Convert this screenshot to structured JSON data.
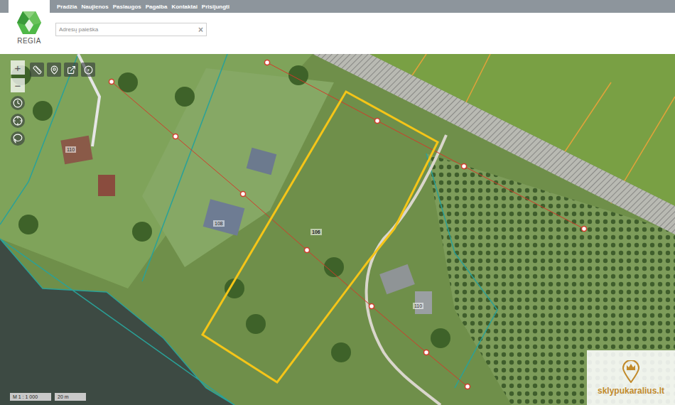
{
  "header": {
    "logo": "REGIA",
    "nav": [
      "Pradžia",
      "Naujienos",
      "Paslaugos",
      "Pagalba",
      "Kontaktai",
      "Prisijungti"
    ]
  },
  "search": {
    "placeholder": "Adresų paieška",
    "clear": "×"
  },
  "zoom": {
    "in": "+",
    "out": "−"
  },
  "parcels": [
    {
      "number": "110",
      "selected": false
    },
    {
      "number": "108",
      "selected": false
    },
    {
      "number": "106",
      "selected": true
    },
    {
      "number": "110",
      "selected": false
    }
  ],
  "scale": {
    "ratio": "M 1 : 1 000",
    "distance": "20 m"
  },
  "watermark": {
    "text": "sklypukaralius.lt"
  }
}
